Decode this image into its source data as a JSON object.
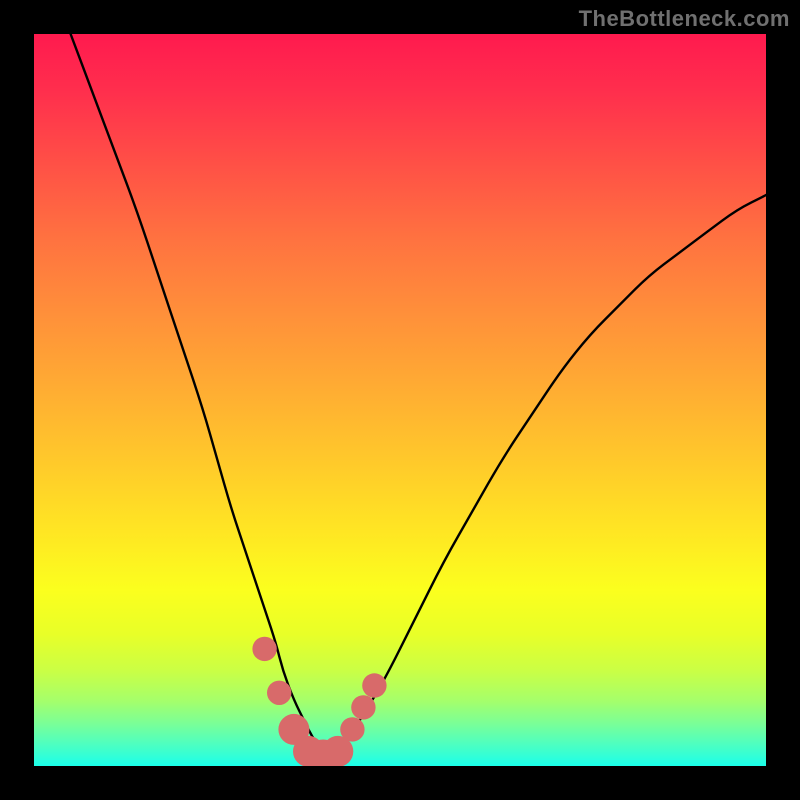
{
  "watermark": "TheBottleneck.com",
  "colors": {
    "page_bg": "#000000",
    "curve": "#000000",
    "marker": "#d86a6a",
    "gradient_top": "#ff1a4e",
    "gradient_bottom": "#1bffea"
  },
  "chart_data": {
    "type": "line",
    "title": "",
    "xlabel": "",
    "ylabel": "",
    "xlim": [
      0,
      100
    ],
    "ylim": [
      0,
      100
    ],
    "grid": false,
    "legend": false,
    "series": [
      {
        "name": "bottleneck-curve",
        "x": [
          5,
          8,
          11,
          14,
          17,
          20,
          23,
          25,
          27,
          29,
          31,
          33,
          34,
          35.5,
          37,
          38,
          39,
          40,
          41.5,
          43,
          45,
          48,
          52,
          56,
          60,
          64,
          68,
          72,
          76,
          80,
          84,
          88,
          92,
          96,
          100
        ],
        "y": [
          100,
          92,
          84,
          76,
          67,
          58,
          49,
          42,
          35,
          29,
          23,
          17,
          13,
          9,
          6,
          4,
          2.5,
          2,
          2.5,
          4,
          7,
          12,
          20,
          28,
          35,
          42,
          48,
          54,
          59,
          63,
          67,
          70,
          73,
          76,
          78
        ]
      }
    ],
    "markers": [
      {
        "x": 31.5,
        "y": 16,
        "r": 1.1
      },
      {
        "x": 33.5,
        "y": 10,
        "r": 1.1
      },
      {
        "x": 35.5,
        "y": 5,
        "r": 1.6
      },
      {
        "x": 37.5,
        "y": 2,
        "r": 1.6
      },
      {
        "x": 39.5,
        "y": 1.5,
        "r": 1.6
      },
      {
        "x": 41.5,
        "y": 2,
        "r": 1.6
      },
      {
        "x": 43.5,
        "y": 5,
        "r": 1.1
      },
      {
        "x": 45.0,
        "y": 8,
        "r": 1.1
      },
      {
        "x": 46.5,
        "y": 11,
        "r": 1.1
      }
    ],
    "background_gradient_stops": [
      {
        "pos": 0.0,
        "color": "#ff1a4e"
      },
      {
        "pos": 0.18,
        "color": "#ff5146"
      },
      {
        "pos": 0.38,
        "color": "#ff8f3a"
      },
      {
        "pos": 0.58,
        "color": "#ffc82b"
      },
      {
        "pos": 0.76,
        "color": "#fbff1e"
      },
      {
        "pos": 0.91,
        "color": "#a6ff6a"
      },
      {
        "pos": 1.0,
        "color": "#1bffea"
      }
    ],
    "notes": "Axes have no visible tick labels; y increases upward; values estimated from pixel positions relative to plot area."
  }
}
